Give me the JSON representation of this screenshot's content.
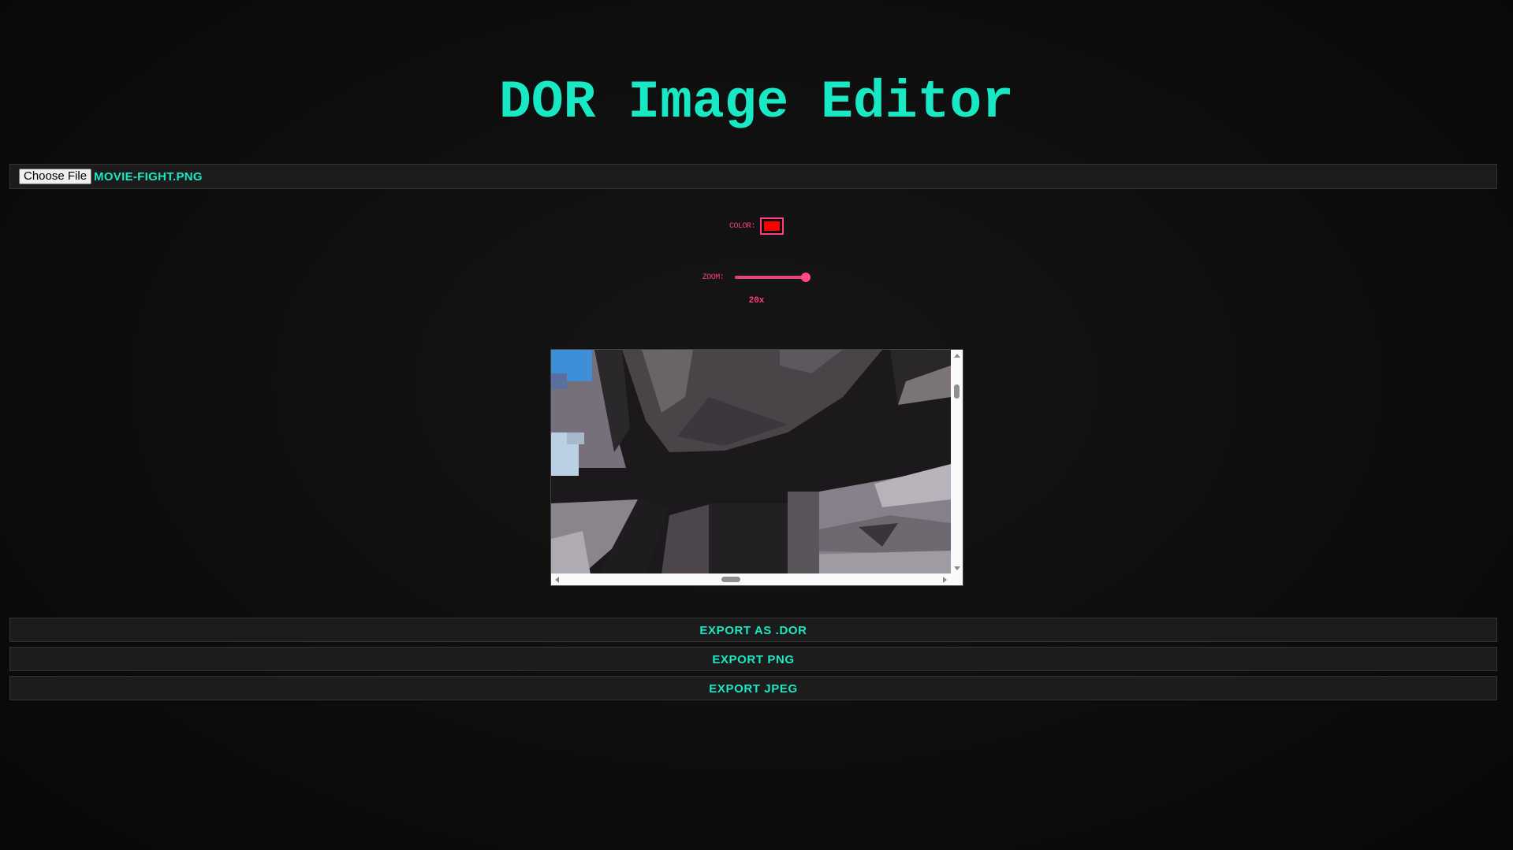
{
  "header": {
    "title": "DOR Image Editor"
  },
  "file_input": {
    "button_label": "Choose File",
    "file_name": "MOVIE-FIGHT.PNG"
  },
  "color_picker": {
    "label": "COLOR:",
    "value": "#ff0000"
  },
  "zoom": {
    "label": "ZOOM:",
    "value_text": "20x",
    "slider_fraction": 1.0
  },
  "canvas": {
    "scroll_horizontal_fraction": 0.43,
    "scroll_vertical_fraction": 0.15
  },
  "actions": {
    "export_dor": "EXPORT AS .DOR",
    "export_png": "EXPORT PNG",
    "export_jpeg": "EXPORT JPEG"
  },
  "colors": {
    "accent": "#19e8c4",
    "secondary": "#ff3f7a",
    "background": "#0d0d0d"
  }
}
